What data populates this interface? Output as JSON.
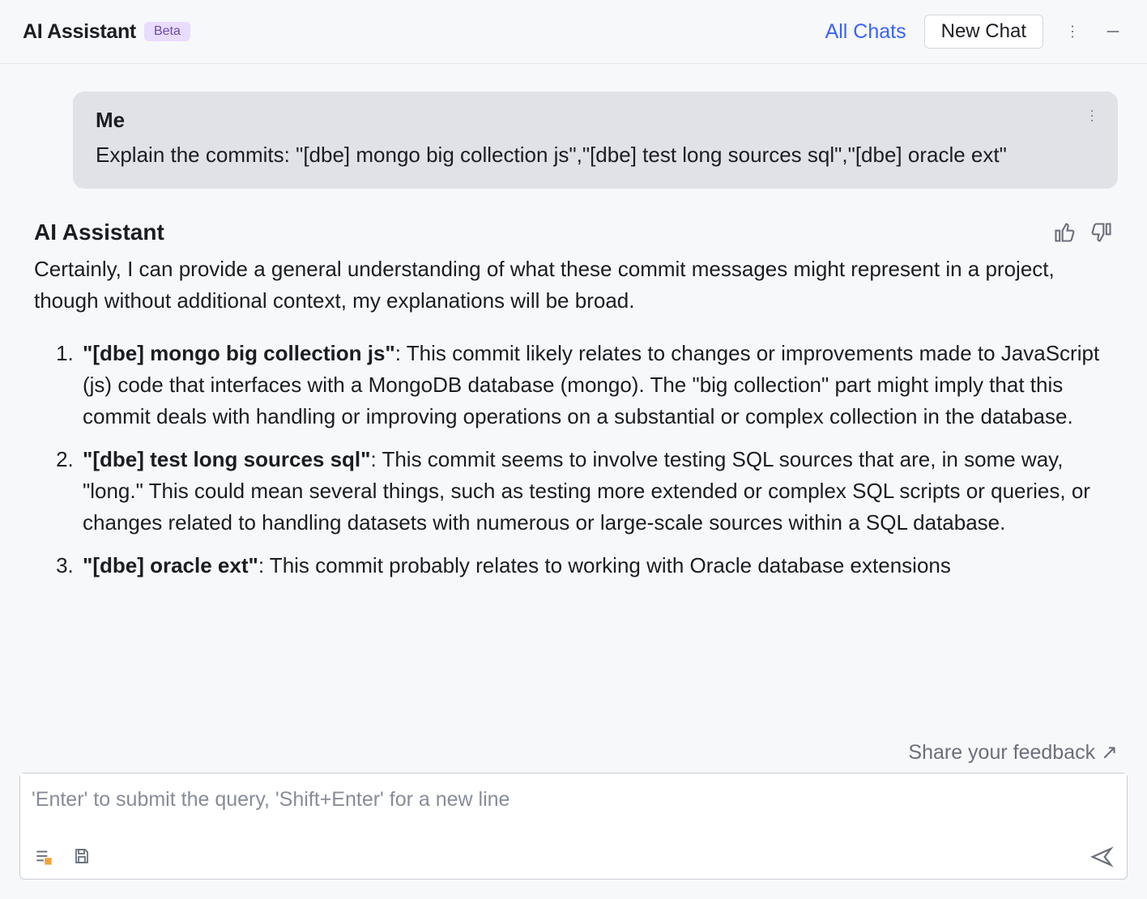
{
  "header": {
    "title": "AI Assistant",
    "badge": "Beta",
    "all_chats": "All Chats",
    "new_chat": "New Chat"
  },
  "conversation": {
    "user": {
      "sender": "Me",
      "text": "Explain the commits: \"[dbe] mongo big collection js\",\"[dbe] test long sources sql\",\"[dbe] oracle ext\""
    },
    "assistant": {
      "sender": "AI Assistant",
      "intro": "Certainly, I can provide a general understanding of what these commit messages might represent in a project, though without additional context, my explanations will be broad.",
      "items": [
        {
          "bold": "\"[dbe] mongo big collection js\"",
          "rest": ": This commit likely relates to changes or improvements made to JavaScript (js) code that interfaces with a MongoDB database (mongo). The \"big collection\" part might imply that this commit deals with handling or improving operations on a substantial or complex collection in the database."
        },
        {
          "bold": "\"[dbe] test long sources sql\"",
          "rest": ": This commit seems to involve testing SQL sources that are, in some way, \"long.\" This could mean several things, such as testing more extended or complex SQL scripts or queries, or changes related to handling datasets with numerous or large-scale sources within a SQL database."
        },
        {
          "bold": "\"[dbe] oracle ext\"",
          "rest": ": This commit probably relates to working with Oracle database extensions"
        }
      ]
    }
  },
  "footer": {
    "feedback_link": "Share your feedback",
    "input_placeholder": "'Enter' to submit the query, 'Shift+Enter' for a new line"
  }
}
